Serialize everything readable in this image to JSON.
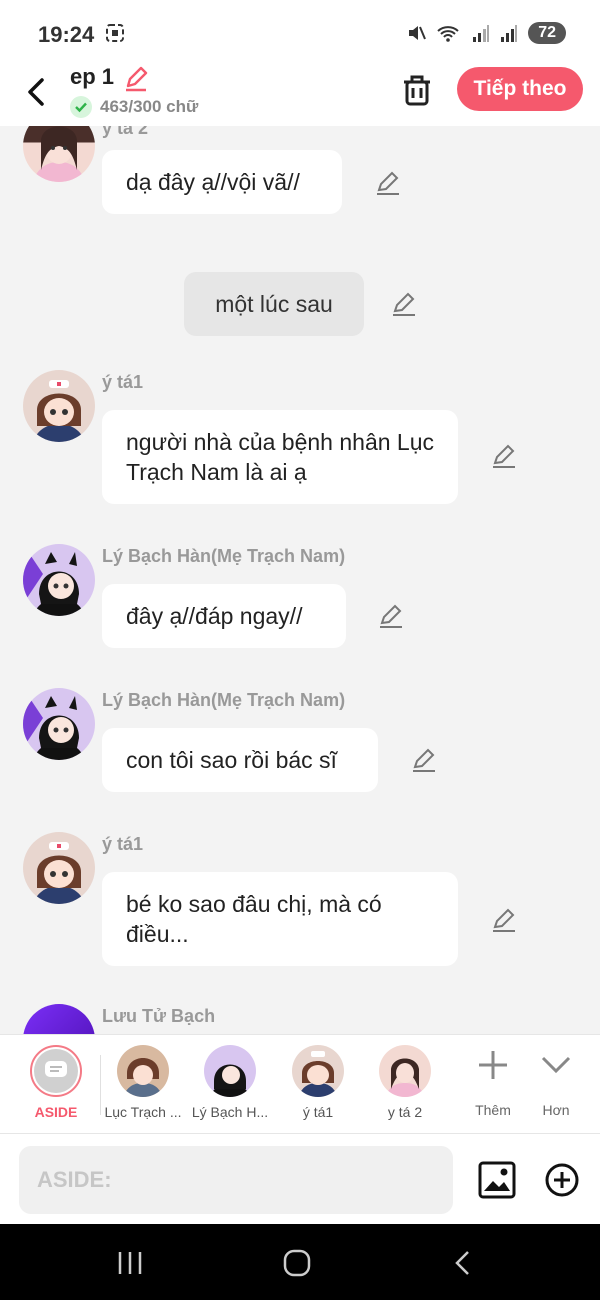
{
  "status": {
    "time": "19:24",
    "battery": "72"
  },
  "header": {
    "title": "ep 1",
    "word_count": "463/300 chữ",
    "next_label": "Tiếp theo"
  },
  "messages": [
    {
      "name": "y tá 2",
      "text": "dạ đây ạ//vội vã//"
    },
    {
      "narration": "một lúc sau"
    },
    {
      "name": "ý tá1",
      "text": "người nhà của bệnh nhân Lục Trạch Nam là ai ạ"
    },
    {
      "name": "Lý Bạch Hàn(Mẹ Trạch Nam)",
      "text": "đây ạ//đáp ngay//"
    },
    {
      "name": "Lý Bạch Hàn(Mẹ Trạch Nam)",
      "text": "con tôi sao rồi bác sĩ"
    },
    {
      "name": "ý tá1",
      "text": "bé ko sao đâu chị, mà có điều..."
    },
    {
      "name": "Lưu Tử Bạch"
    }
  ],
  "characters": [
    {
      "label": "ASIDE"
    },
    {
      "label": "Lục Trạch ..."
    },
    {
      "label": "Lý Bạch H..."
    },
    {
      "label": "ý tá1"
    },
    {
      "label": "y tá 2"
    }
  ],
  "tools": {
    "add_label": "Thêm",
    "more_label": "Hơn"
  },
  "input": {
    "placeholder": "ASIDE:"
  },
  "colors": {
    "accent": "#f5596d",
    "background": "#f3f3f3",
    "bubble": "#ffffff"
  }
}
